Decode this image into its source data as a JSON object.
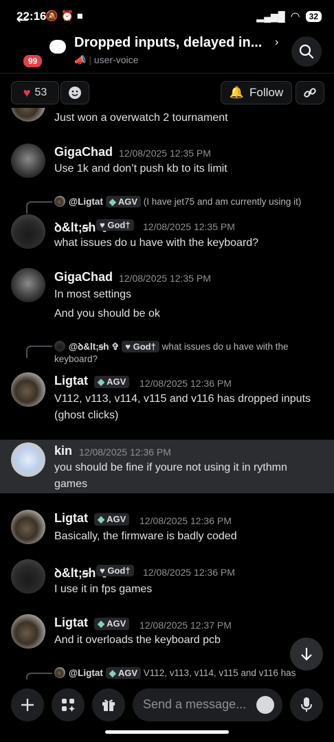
{
  "status_bar": {
    "time": "22:16",
    "battery": "32"
  },
  "header": {
    "unread_badge": "99",
    "title": "Dropped inputs, delayed in...",
    "channel": "user-voice"
  },
  "toolbar": {
    "reaction_count": "53",
    "follow_label": "Follow"
  },
  "messages": [
    {
      "body": "Just won a overwatch 2 tournament"
    },
    {
      "name": "GigaChad",
      "time": "12/08/2025 12:35 PM",
      "body": "Use 1k and don’t push kb to its limit"
    },
    {
      "reply_name": "@Ligtat",
      "reply_tag": "AGV",
      "reply_text": "(I have jet75 and am currently using it)",
      "name": "ꝺ&lt;ꞩh ✞",
      "tag": "God†",
      "time": "12/08/2025 12:35 PM",
      "body": "what issues do u have with the keyboard?"
    },
    {
      "name": "GigaChad",
      "time": "12/08/2025 12:35 PM",
      "body": "In most settings",
      "body2": "And you should be ok"
    },
    {
      "reply_name": "@ꝺ&lt;ꞩh ✞",
      "reply_tag": "God†",
      "reply_text": "what issues do u have with the",
      "reply_text2": "keyboard?",
      "name": "Ligtat",
      "tag": "AGV",
      "time": "12/08/2025 12:36 PM",
      "body": "V112, v113, v114, v115 and v116 has dropped inputs",
      "body2": "(ghost clicks)"
    },
    {
      "name": "kin",
      "time": "12/08/2025 12:36 PM",
      "body": "you should be fine if youre not using it in rythmn",
      "body2": "games"
    },
    {
      "name": "Ligtat",
      "tag": "AGV",
      "time": "12/08/2025 12:36 PM",
      "body": "Basically, the firmware is badly coded"
    },
    {
      "name": "ꝺ&lt;ꞩh ✞",
      "tag": "God†",
      "time": "12/08/2025 12:36 PM",
      "body": "I use it in fps games"
    },
    {
      "name": "Ligtat",
      "tag": "AGV",
      "time": "12/08/2025 12:37 PM",
      "body": "And it overloads the keyboard pcb"
    },
    {
      "reply_name": "@Ligtat",
      "reply_tag": "AGV",
      "reply_text": "V112, v113, v114, v115 and v116 has"
    }
  ],
  "composer": {
    "placeholder": "Send a message..."
  },
  "colors": {
    "background": "#000000",
    "highlight": "#2b2d31",
    "badge": "#e0424a",
    "tag_gem": "#86d0b8"
  }
}
